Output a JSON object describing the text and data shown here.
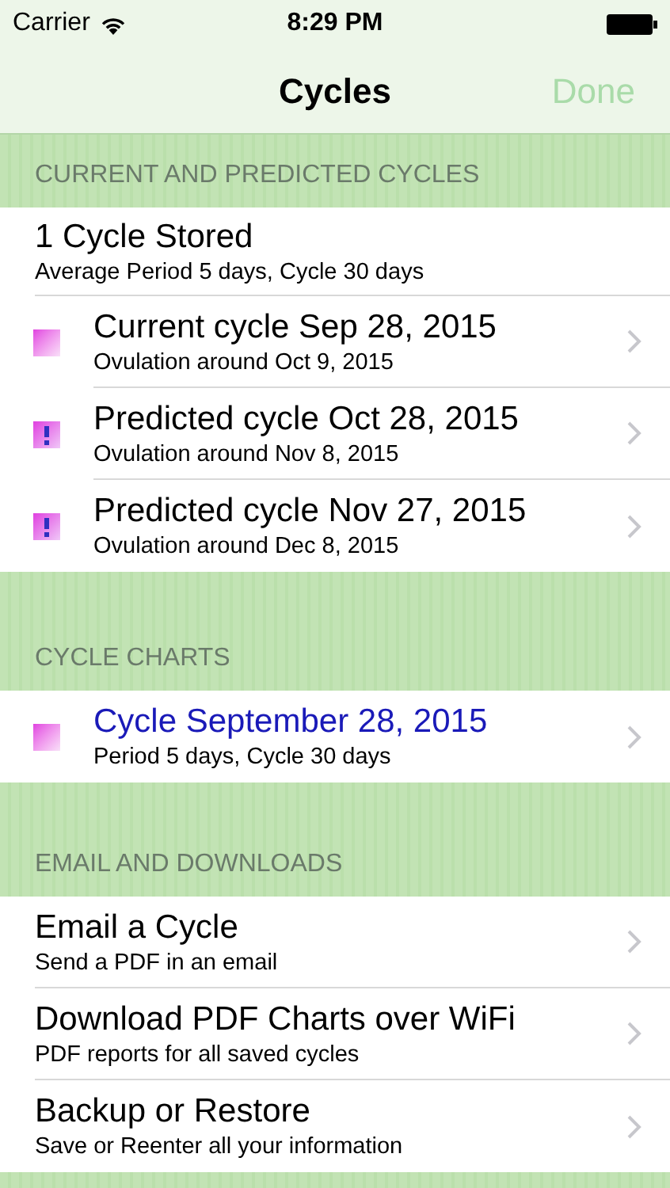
{
  "status_bar": {
    "carrier": "Carrier",
    "time": "8:29 PM"
  },
  "nav": {
    "title": "Cycles",
    "done": {
      "label": "Done",
      "disabled": true
    }
  },
  "sections": [
    {
      "header": "CURRENT AND PREDICTED CYCLES",
      "items": [
        {
          "kind": "summary",
          "title": "1 Cycle Stored",
          "subtitle": "Average Period 5 days, Cycle 30 days"
        },
        {
          "kind": "current",
          "link": false,
          "title": "Current cycle Sep 28, 2015",
          "subtitle": "Ovulation around Oct 9, 2015"
        },
        {
          "kind": "predicted",
          "link": false,
          "title": "Predicted cycle Oct 28, 2015",
          "subtitle": "Ovulation around Nov 8, 2015"
        },
        {
          "kind": "predicted",
          "link": false,
          "title": "Predicted cycle Nov 27, 2015",
          "subtitle": "Ovulation around Dec 8, 2015"
        }
      ]
    },
    {
      "header": "CYCLE CHARTS",
      "items": [
        {
          "kind": "current",
          "link": true,
          "title": "Cycle September 28, 2015",
          "subtitle": "Period 5 days, Cycle 30 days"
        }
      ]
    },
    {
      "header": "EMAIL AND DOWNLOADS",
      "items": [
        {
          "kind": "action",
          "title": "Email a Cycle",
          "subtitle": "Send a PDF in an email"
        },
        {
          "kind": "action",
          "title": "Download PDF Charts over WiFi",
          "subtitle": "PDF reports for all saved cycles"
        },
        {
          "kind": "action",
          "title": "Backup or Restore",
          "subtitle": "Save or Reenter all your information"
        }
      ]
    }
  ]
}
